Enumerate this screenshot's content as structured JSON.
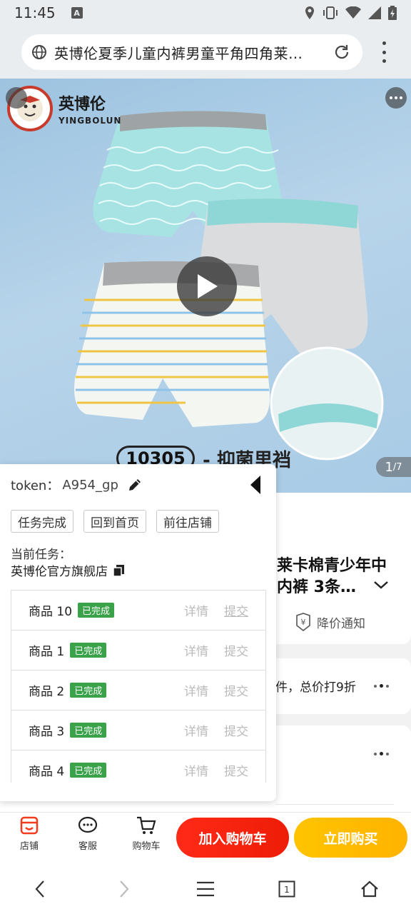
{
  "status_bar": {
    "time": "11:45",
    "notification_icon": "A"
  },
  "browser": {
    "url_title": "英博伦夏季儿童内裤男童平角四角莱…"
  },
  "product_image": {
    "logo_cn": "英博伦",
    "logo_en": "YINGBOLUN",
    "caption_code": "10305",
    "caption_text": "- 抑菌里裆",
    "page_current": "1",
    "page_total": "/7"
  },
  "product_info": {
    "title": "莱卡棉青少年中内裤 3条…",
    "price_notice": "降价通知",
    "discount": "件，总价打9折"
  },
  "token_panel": {
    "token_label": "token：",
    "token_value": "A954_gp",
    "buttons": [
      "任务完成",
      "回到首页",
      "前往店铺"
    ],
    "task_label": "当前任务：",
    "task_name": "英博伦官方旗舰店",
    "detail_label": "详情",
    "submit_label": "提交",
    "items": [
      {
        "name": "商品 10",
        "status": "已完成"
      },
      {
        "name": "商品 1",
        "status": "已完成"
      },
      {
        "name": "商品 2",
        "status": "已完成"
      },
      {
        "name": "商品 3",
        "status": "已完成"
      },
      {
        "name": "商品 4",
        "status": "已完成"
      }
    ]
  },
  "bottom_bar": {
    "store": "店铺",
    "service": "客服",
    "cart": "购物车",
    "add_to_cart": "加入购物车",
    "buy_now": "立即购买"
  },
  "nav_bar": {
    "tabs_count": "1"
  },
  "colors": {
    "accent_red": "#ff2a17",
    "accent_yellow": "#ffc400",
    "done_green": "#3aa34a"
  }
}
